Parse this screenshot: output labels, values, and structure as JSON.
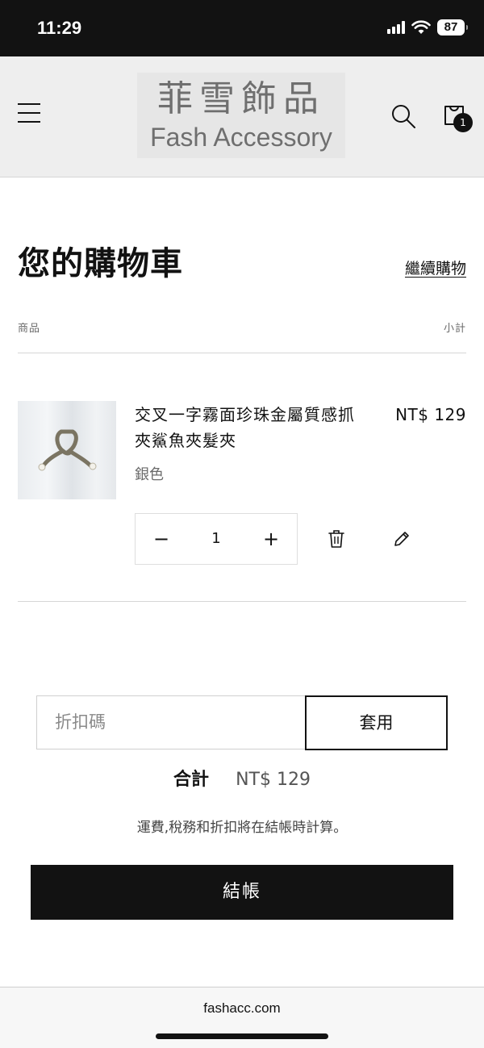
{
  "status_bar": {
    "time": "11:29",
    "battery": "87",
    "icons": [
      "signal-icon",
      "wifi-icon",
      "battery-icon"
    ]
  },
  "header": {
    "logo_cn": "菲雪飾品",
    "logo_en": "Fash Accessory",
    "cart_count": "1",
    "icons": [
      "menu-icon",
      "search-icon",
      "cart-icon"
    ]
  },
  "cart": {
    "title": "您的購物車",
    "continue_label": "繼續購物",
    "col_product": "商品",
    "col_subtotal": "小計",
    "items": [
      {
        "name": "交叉一字霧面珍珠金屬質感抓夾鯊魚夾髮夾",
        "price": "NT$ 129",
        "variant": "銀色",
        "quantity": "1",
        "minus_label": "−",
        "plus_label": "+"
      }
    ]
  },
  "discount": {
    "placeholder": "折扣碼",
    "apply_label": "套用"
  },
  "summary": {
    "total_label": "合計",
    "total_value": "NT$ 129",
    "tax_note": "運費,稅務和折扣將在結帳時計算。",
    "checkout_label": "結帳"
  },
  "browser": {
    "url": "fashacc.com"
  },
  "colors": {
    "primary": "#121212",
    "header_bg": "#eeeeee",
    "muted_text": "#6b6b6b"
  }
}
